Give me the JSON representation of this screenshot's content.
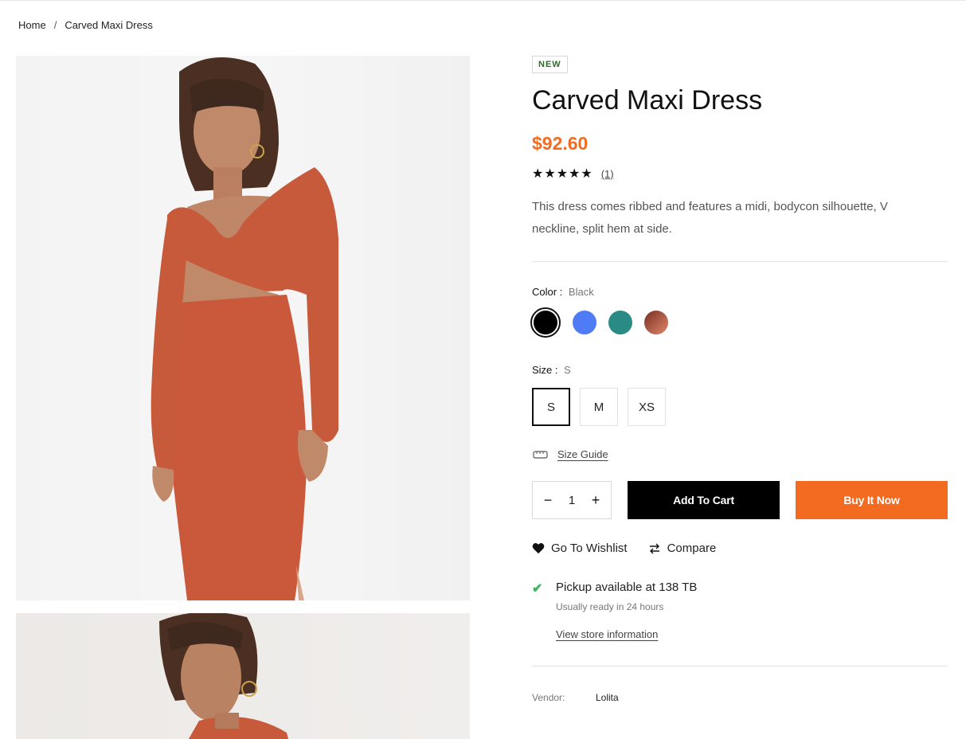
{
  "breadcrumb": {
    "home": "Home",
    "separator": "/",
    "current": "Carved Maxi Dress"
  },
  "product": {
    "badge": "NEW",
    "title": "Carved Maxi Dress",
    "price": "$92.60",
    "stars": "★★★★★",
    "review_count": "(1)",
    "description": "This dress comes ribbed and features a midi, bodycon silhouette, V neckline, split hem at side."
  },
  "color": {
    "label": "Color :",
    "selected": "Black",
    "swatches": [
      {
        "name": "Black",
        "hex": "#000000"
      },
      {
        "name": "Blue",
        "hex": "#4f7cf6"
      },
      {
        "name": "Teal",
        "hex": "#2a8a84"
      },
      {
        "name": "Rust",
        "hex": "#b4533c"
      }
    ]
  },
  "size": {
    "label": "Size :",
    "selected": "S",
    "options": [
      "S",
      "M",
      "XS"
    ],
    "guide_label": "Size Guide"
  },
  "cart": {
    "qty_minus": "−",
    "quantity": "1",
    "qty_plus": "+",
    "add_to_cart": "Add To Cart",
    "buy_now": "Buy It Now"
  },
  "actions": {
    "wishlist": "Go To Wishlist",
    "compare": "Compare"
  },
  "pickup": {
    "check": "✔",
    "title": "Pickup available at 138 TB",
    "subtitle": "Usually ready in 24 hours",
    "store_link": "View store information"
  },
  "meta": {
    "vendor_label": "Vendor:",
    "vendor_value": "Lolita"
  },
  "colors": {
    "accent": "#f26b21",
    "dark": "#000000",
    "success": "#3cb55a"
  }
}
